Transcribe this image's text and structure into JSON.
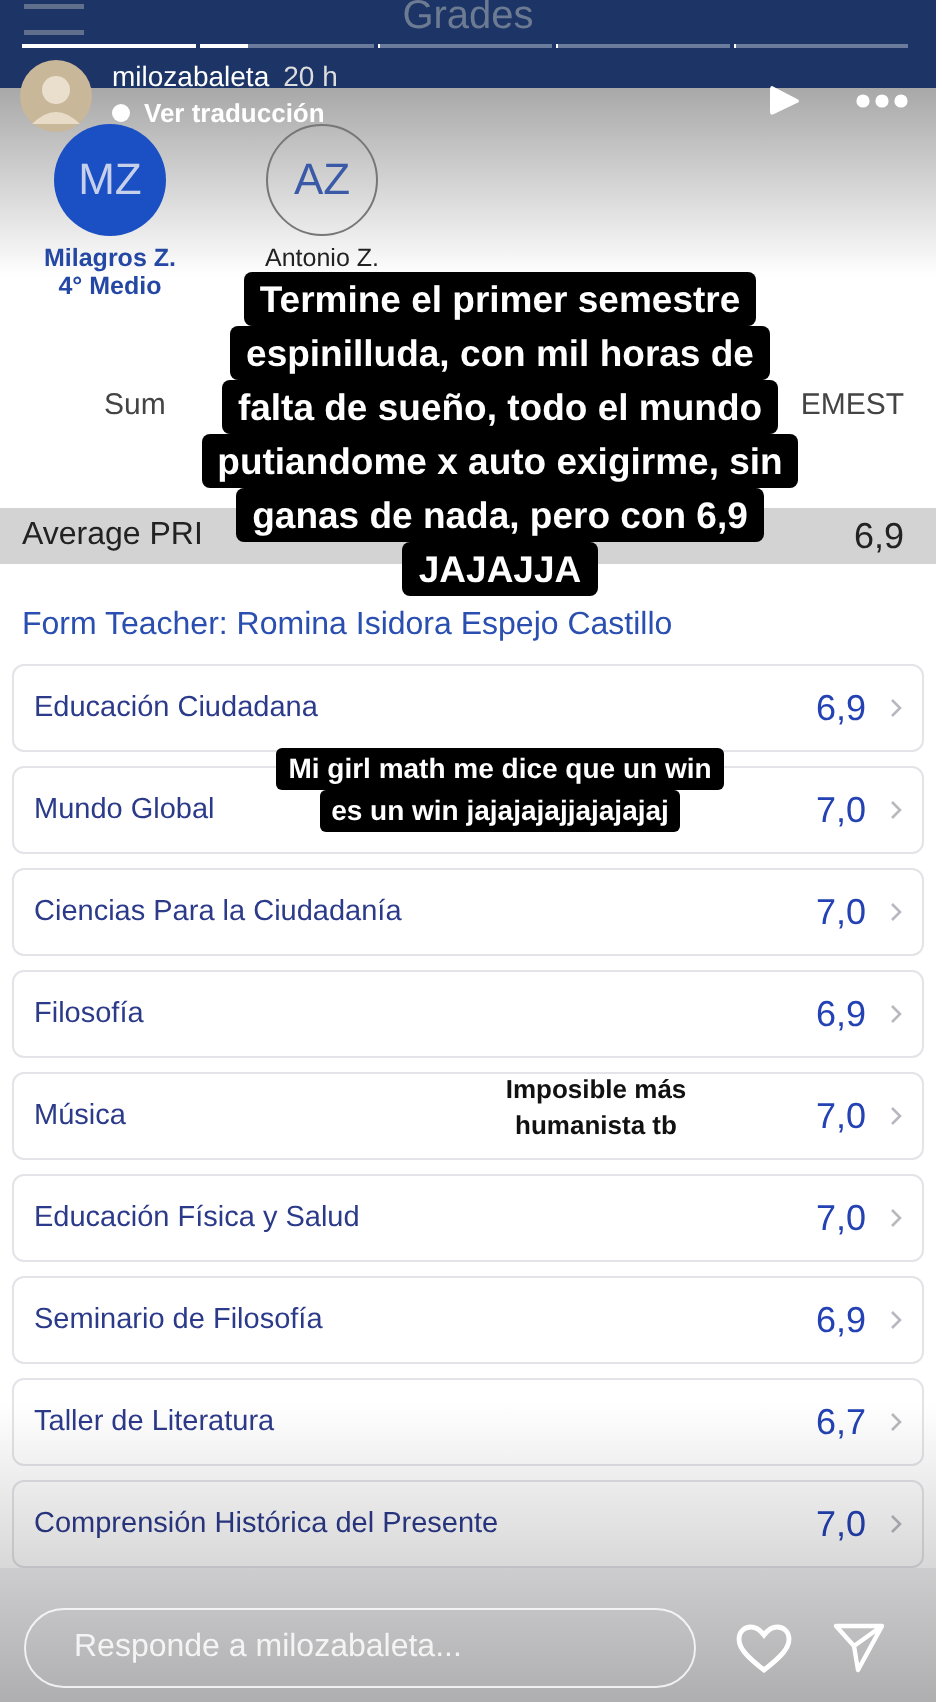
{
  "story": {
    "username": "milozabaleta",
    "time": "20 h",
    "translation": "Ver traducción",
    "segments": [
      {
        "level": 1
      },
      {
        "level": 0.28
      },
      {
        "level": 0
      },
      {
        "level": 0
      },
      {
        "level": 0
      }
    ]
  },
  "app": {
    "title": "Grades",
    "students": [
      {
        "initials": "MZ",
        "name": "Milagros Z.",
        "grade": "4° Medio",
        "selected": true
      },
      {
        "initials": "AZ",
        "name": "Antonio Z.",
        "selected": false
      }
    ],
    "summary_left": "Sum",
    "summary_right": "EMEST",
    "average": {
      "label": "Average PRI",
      "value": "6,9"
    },
    "form_teacher": "Form Teacher: Romina Isidora Espejo Castillo",
    "subjects": [
      {
        "name": "Educación Ciudadana",
        "grade": "6,9"
      },
      {
        "name": "Mundo Global",
        "grade": "7,0"
      },
      {
        "name": "Ciencias Para la Ciudadanía",
        "grade": "7,0"
      },
      {
        "name": "Filosofía",
        "grade": "6,9"
      },
      {
        "name": "Música",
        "grade": "7,0"
      },
      {
        "name": "Educación Física y Salud",
        "grade": "7,0"
      },
      {
        "name": "Seminario de Filosofía",
        "grade": "6,9"
      },
      {
        "name": "Taller de Literatura",
        "grade": "6,7"
      },
      {
        "name": "Comprensión Histórica del Presente",
        "grade": "7,0"
      }
    ]
  },
  "captions": [
    {
      "kind": "boxed",
      "lines": [
        "Termine el primer semestre",
        "espinilluda, con mil horas de",
        "falta de sueño, todo el mundo",
        "putiandome x auto exigirme, sin",
        "ganas de nada, pero con 6,9",
        "JAJAJJA"
      ]
    },
    {
      "kind": "boxed-small",
      "lines": [
        "Mi girl math me dice que un win",
        "es un win jajajajajjajajajaj"
      ]
    },
    {
      "kind": "plain",
      "lines": [
        "Imposible más",
        "humanista tb"
      ]
    }
  ],
  "reply": {
    "placeholder": "Responde a milozabaleta..."
  }
}
